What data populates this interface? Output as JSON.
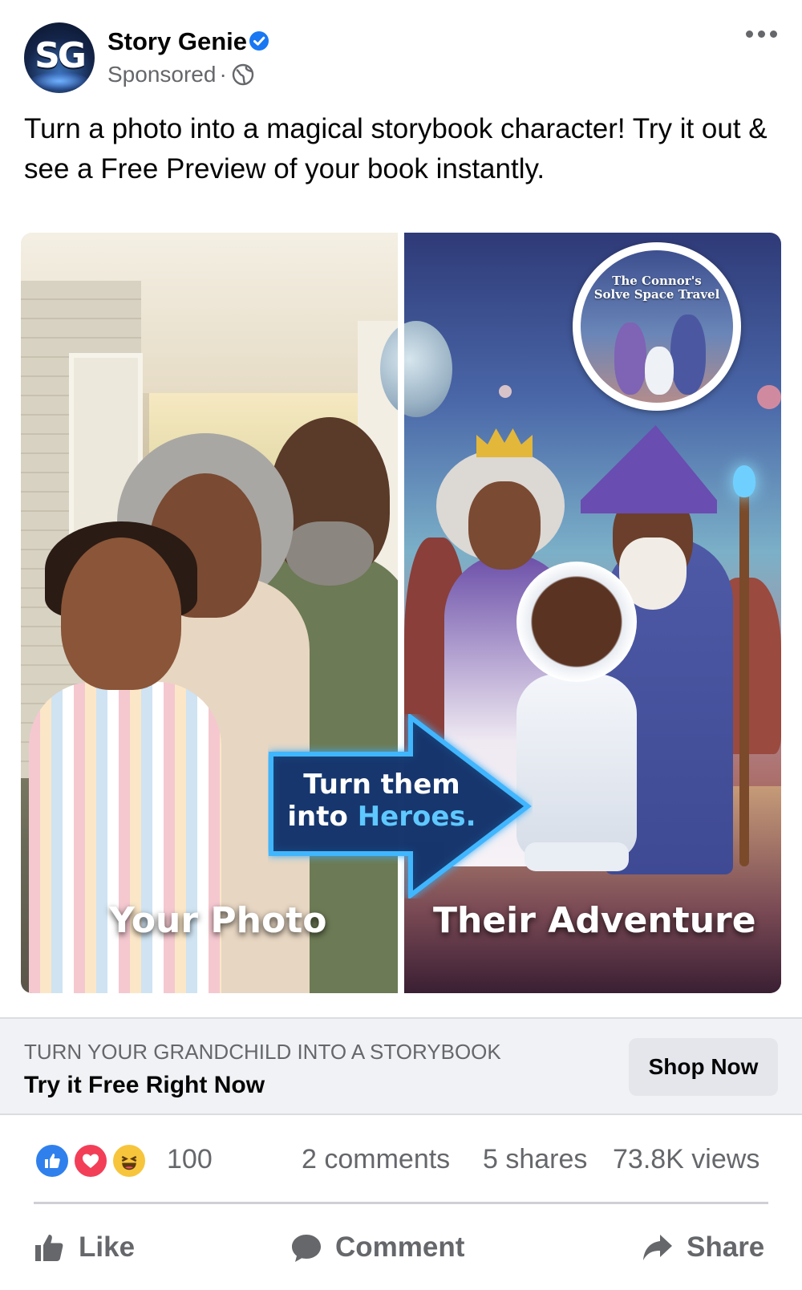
{
  "post": {
    "page_name": "Story Genie",
    "avatar_text": "SG",
    "sponsored": "Sponsored",
    "separator": "·",
    "caption": "Turn a photo into a magical storybook character! Try it out & see a Free Preview of your book instantly."
  },
  "creative": {
    "left_label": "Your Photo",
    "right_label": "Their Adventure",
    "arrow_line1": "Turn them",
    "arrow_line2_prefix": "into ",
    "arrow_line2_highlight": "Heroes.",
    "book_title_line1": "The Connor's",
    "book_title_line2": "Solve Space Travel"
  },
  "cta": {
    "subtitle": "TURN YOUR GRANDCHILD INTO A STORYBOOK",
    "title": "Try it Free Right Now",
    "button": "Shop Now"
  },
  "stats": {
    "reaction_count": "100",
    "comments": "2 comments",
    "shares": "5 shares",
    "views": "73.8K views"
  },
  "actions": {
    "like": "Like",
    "comment": "Comment",
    "share": "Share"
  },
  "colors": {
    "verified_blue": "#1877f2",
    "like_blue": "#2f80ed",
    "love_red": "#f33e58",
    "haha_yellow": "#f7c53b",
    "arrow_glow": "#3fb6ff"
  },
  "icons": [
    "verified-badge-icon",
    "globe-icon",
    "more-options-icon",
    "like-reaction-icon",
    "love-reaction-icon",
    "haha-reaction-icon",
    "thumbs-up-icon",
    "comment-icon",
    "share-icon"
  ]
}
